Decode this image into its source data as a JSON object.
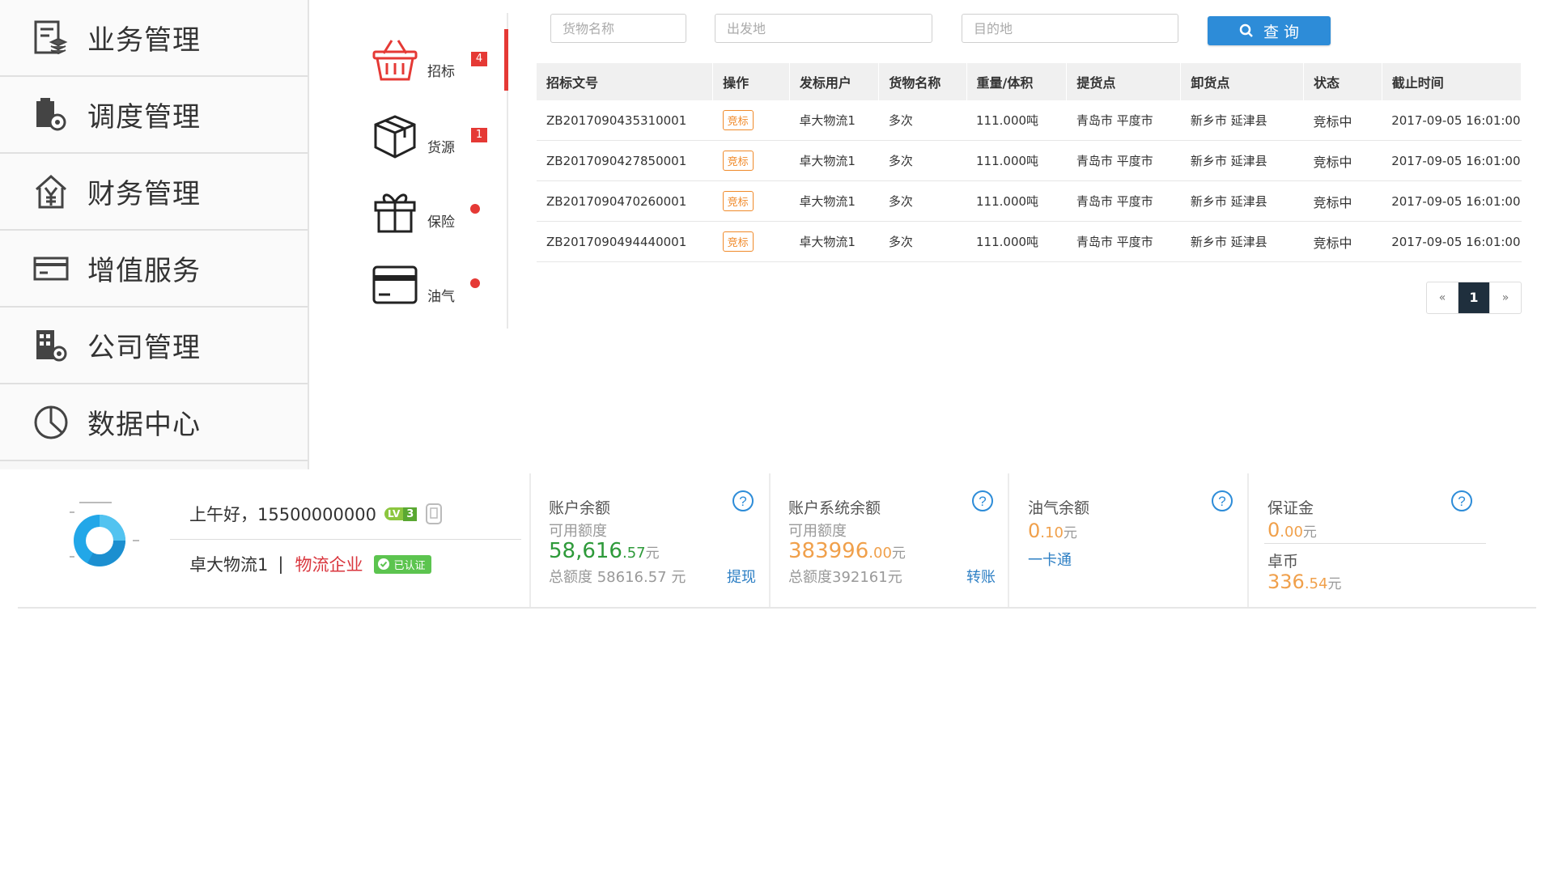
{
  "nav": {
    "items": [
      {
        "label": "业务管理",
        "icon": "business-doc-icon"
      },
      {
        "label": "调度管理",
        "icon": "dispatch-gear-icon"
      },
      {
        "label": "财务管理",
        "icon": "finance-yen-icon"
      },
      {
        "label": "增值服务",
        "icon": "card-icon"
      },
      {
        "label": "公司管理",
        "icon": "company-building-icon"
      },
      {
        "label": "数据中心",
        "icon": "pie-chart-icon"
      }
    ]
  },
  "quick": {
    "items": [
      {
        "label": "招标",
        "icon": "basket-icon",
        "badge": "4"
      },
      {
        "label": "货源",
        "icon": "box-icon",
        "badge": "1"
      },
      {
        "label": "保险",
        "icon": "gift-icon",
        "dot": true
      },
      {
        "label": "油气",
        "icon": "card-icon",
        "dot": true
      }
    ]
  },
  "search": {
    "cargo_placeholder": "货物名称",
    "origin_placeholder": "出发地",
    "dest_placeholder": "目的地",
    "button_label": "查 询"
  },
  "table": {
    "headers": [
      "招标文号",
      "操作",
      "发标用户",
      "货物名称",
      "重量/体积",
      "提货点",
      "卸货点",
      "状态",
      "截止时间"
    ],
    "rows": [
      [
        "ZB2017090435310001",
        "竞标",
        "卓大物流1",
        "多次",
        "111.000吨",
        "青岛市 平度市",
        "新乡市 延津县",
        "竞标中",
        "2017-09-05 16:01:00"
      ],
      [
        "ZB2017090427850001",
        "竞标",
        "卓大物流1",
        "多次",
        "111.000吨",
        "青岛市 平度市",
        "新乡市 延津县",
        "竞标中",
        "2017-09-05 16:01:00"
      ],
      [
        "ZB2017090470260001",
        "竞标",
        "卓大物流1",
        "多次",
        "111.000吨",
        "青岛市 平度市",
        "新乡市 延津县",
        "竞标中",
        "2017-09-05 16:01:00"
      ],
      [
        "ZB2017090494440001",
        "竞标",
        "卓大物流1",
        "多次",
        "111.000吨",
        "青岛市 平度市",
        "新乡市 延津县",
        "竞标中",
        "2017-09-05 16:01:00"
      ]
    ]
  },
  "pager": {
    "prev": "«",
    "current": "1",
    "next": "»"
  },
  "user": {
    "greeting": "上午好，15500000000",
    "level_prefix": "LV",
    "level": "3",
    "company": "卓大物流1",
    "separator": "|",
    "company_type": "物流企业",
    "verified": "已认证"
  },
  "accounts": {
    "balance": {
      "title": "账户余额",
      "sub": "可用额度",
      "amount_int": "58,616",
      "amount_dec": ".57",
      "unit": "元",
      "total": "总额度 58616.57 元",
      "action": "提现"
    },
    "system_balance": {
      "title": "账户系统余额",
      "sub": "可用额度",
      "amount_int": "383996",
      "amount_dec": ".00",
      "unit": "元",
      "total": "总额度392161元",
      "action": "转账"
    },
    "oil": {
      "title": "油气余额",
      "amount_int": "0",
      "amount_dec": ".10",
      "unit": "元",
      "link": "一卡通"
    },
    "deposit": {
      "title": "保证金",
      "amount_int": "0",
      "amount_dec": ".00",
      "unit": "元",
      "coin_title": "卓币",
      "coin_int": "336",
      "coin_dec": ".54",
      "coin_unit": "元"
    }
  },
  "colors": {
    "accent_blue": "#2d8cd8",
    "active_red": "#e53935",
    "status_green": "#2e9a3a",
    "amount_green": "#2e9a3a",
    "amount_orange": "#f0a04b",
    "bid_orange": "#f08a2a"
  }
}
